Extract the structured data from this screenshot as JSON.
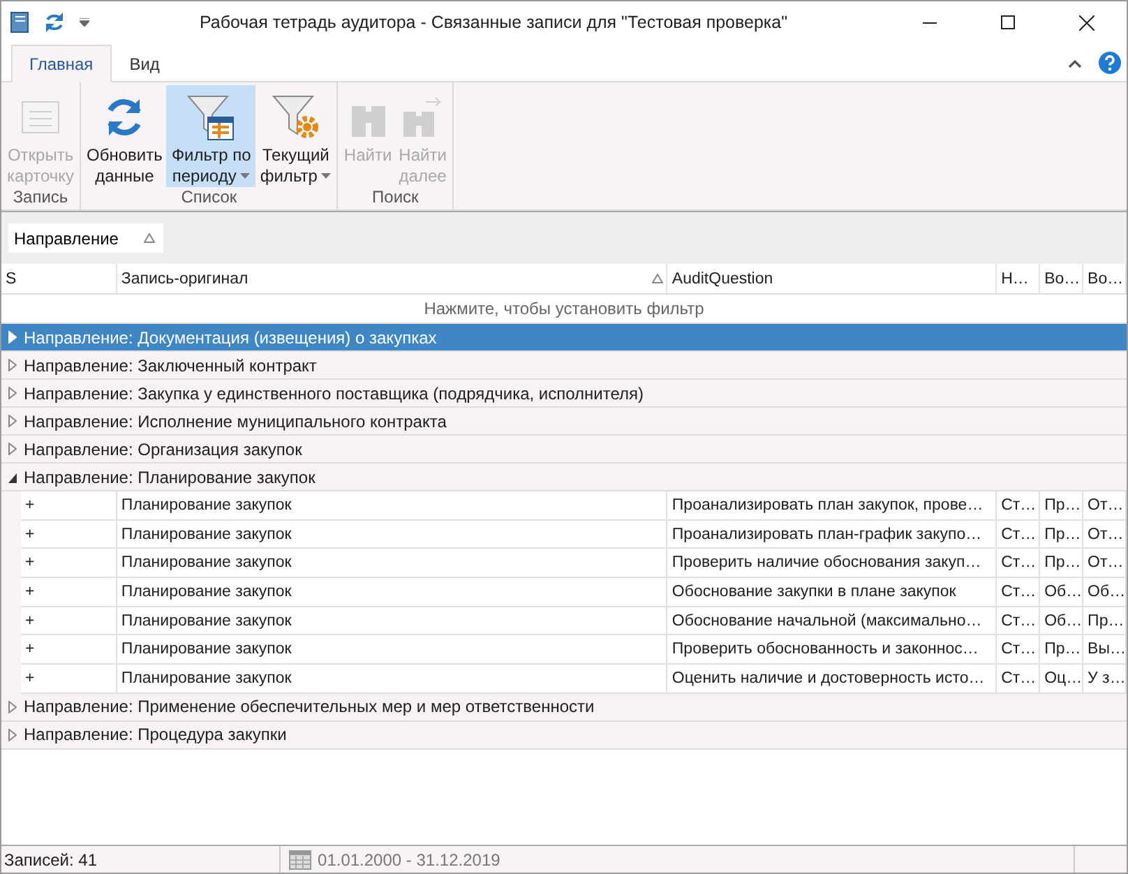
{
  "window": {
    "title": "Рабочая тетрадь аудитора - Связанные записи для \"Тестовая проверка\""
  },
  "tabs": [
    {
      "label": "Главная",
      "selected": true
    },
    {
      "label": "Вид",
      "selected": false
    }
  ],
  "ribbon": [
    {
      "label": "Запись",
      "buttons": [
        {
          "kind": "card",
          "lines": [
            "Открыть",
            "карточку"
          ],
          "disabled": true,
          "selected": false,
          "dropdown": false
        }
      ]
    },
    {
      "label": "Список",
      "buttons": [
        {
          "kind": "refresh",
          "lines": [
            "Обновить",
            "данные"
          ],
          "disabled": false,
          "selected": false,
          "dropdown": false
        },
        {
          "kind": "filter-calendar",
          "lines": [
            "Фильтр по",
            "периоду"
          ],
          "disabled": false,
          "selected": true,
          "dropdown": true
        },
        {
          "kind": "filter-gear",
          "lines": [
            "Текущий",
            "фильтр"
          ],
          "disabled": false,
          "selected": false,
          "dropdown": true
        }
      ]
    },
    {
      "label": "Поиск",
      "buttons": [
        {
          "kind": "find",
          "lines": [
            "Найти"
          ],
          "disabled": true,
          "selected": false,
          "dropdown": false
        },
        {
          "kind": "find-next",
          "lines": [
            "Найти",
            "далее"
          ],
          "disabled": true,
          "selected": false,
          "dropdown": false
        }
      ]
    }
  ],
  "group_by": {
    "label": "Направление"
  },
  "table": {
    "columns": [
      {
        "label": "S",
        "sorted": false
      },
      {
        "label": "Запись-оригинал",
        "sorted": true
      },
      {
        "label": "AuditQuestion",
        "sorted": false
      },
      {
        "label": "Н…",
        "sorted": false
      },
      {
        "label": "Во…",
        "sorted": false
      },
      {
        "label": "Во…",
        "sorted": false
      }
    ],
    "filter_hint": "Нажмите, чтобы установить фильтр",
    "groups": [
      {
        "label": "Направление: Документация (извещения) о закупках",
        "expanded": false,
        "selected": true
      },
      {
        "label": "Направление: Заключенный контракт",
        "expanded": false,
        "selected": false
      },
      {
        "label": "Направление: Закупка у единственного поставщика (подрядчика, исполнителя)",
        "expanded": false,
        "selected": false
      },
      {
        "label": "Направление: Исполнение муниципального контракта",
        "expanded": false,
        "selected": false
      },
      {
        "label": "Направление: Организация закупок",
        "expanded": false,
        "selected": false
      },
      {
        "label": "Направление: Планирование закупок",
        "expanded": true,
        "selected": false,
        "rows": [
          [
            "+",
            "Планирование закупок",
            "Проанализировать план закупок, прове…",
            "Ст…",
            "Пр…",
            "От…"
          ],
          [
            "+",
            "Планирование закупок",
            "Проанализировать план-график закупо…",
            "Ст…",
            "Пр…",
            "От…"
          ],
          [
            "+",
            "Планирование закупок",
            "Проверить наличие обоснования закуп…",
            "Ст…",
            "Пр…",
            "От…"
          ],
          [
            "+",
            "Планирование закупок",
            "Обоснование закупки в плане закупок",
            "Ст…",
            "Об…",
            "Об…"
          ],
          [
            "+",
            "Планирование закупок",
            "Обоснование начальной (максимально…",
            "Ст…",
            "Об…",
            "Пр…"
          ],
          [
            "+",
            "Планирование закупок",
            "Проверить обоснованность и законнос…",
            "Ст…",
            "Пр…",
            "Вы…"
          ],
          [
            "+",
            "Планирование закупок",
            "Оценить наличие и достоверность исто…",
            "Ст…",
            "Оц…",
            "У з…"
          ]
        ]
      },
      {
        "label": "Направление: Применение обеспечительных мер и мер ответственности",
        "expanded": false,
        "selected": false
      },
      {
        "label": "Направление: Процедура закупки",
        "expanded": false,
        "selected": false
      }
    ]
  },
  "status_bar": {
    "records": "Записей: 41",
    "period": "01.01.2000 - 31.12.2019"
  }
}
